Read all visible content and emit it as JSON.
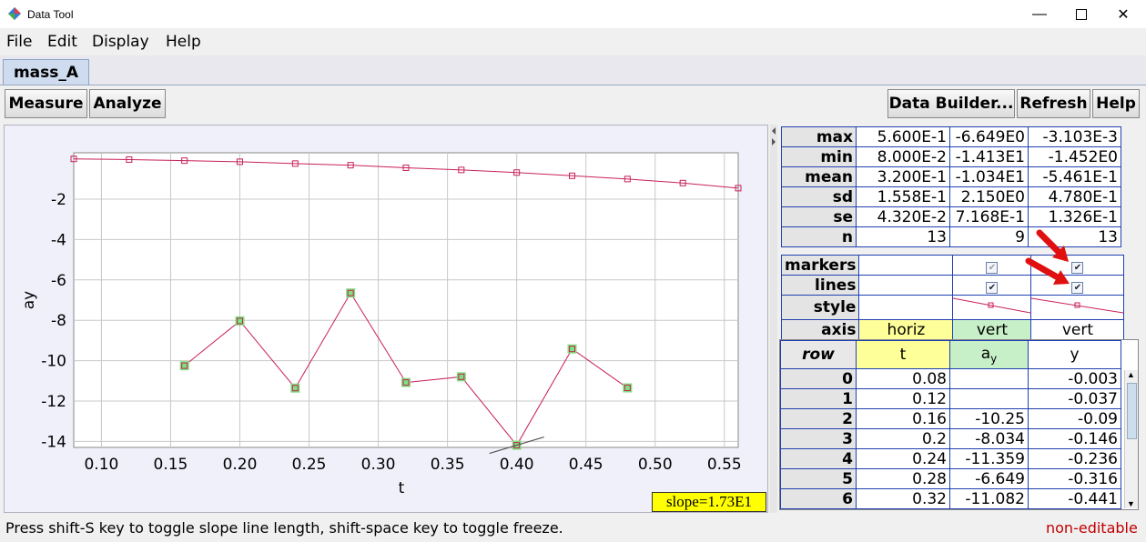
{
  "window": {
    "title": "Data Tool",
    "minimize_icon": "minimize-icon",
    "maximize_icon": "maximize-icon",
    "close_icon": "close-icon"
  },
  "menu": [
    "File",
    "Edit",
    "Display",
    "Help"
  ],
  "tab": {
    "label": "mass_A"
  },
  "toolbar": {
    "measure": "Measure",
    "analyze": "Analyze",
    "data_builder": "Data Builder...",
    "refresh": "Refresh",
    "help": "Help"
  },
  "plot": {
    "xlabel": "t",
    "ylabel": "ay",
    "slope_label": "slope=1.73E1"
  },
  "chart_data": {
    "type": "scatter",
    "xlabel": "t",
    "ylabel": "ay",
    "xlim": [
      0.08,
      0.56
    ],
    "ylim": [
      -14.3,
      0.3
    ],
    "xticks": [
      "0.10",
      "0.15",
      "0.20",
      "0.25",
      "0.30",
      "0.35",
      "0.40",
      "0.45",
      "0.50",
      "0.55"
    ],
    "yticks": [
      "-2",
      "-4",
      "-6",
      "-8",
      "-10",
      "-12",
      "-14"
    ],
    "grid": true,
    "series": [
      {
        "x": [
          0.16,
          0.2,
          0.24,
          0.28,
          0.32,
          0.36,
          0.4,
          0.44,
          0.48
        ],
        "values": [
          -10.25,
          -8.034,
          -11.359,
          -6.649,
          -11.082,
          -10.8,
          -14.19,
          -9.42,
          -11.35
        ],
        "color": "#c8205a",
        "marker_highlight": "#7fe07f"
      },
      {
        "x": [
          0.08,
          0.12,
          0.16,
          0.2,
          0.24,
          0.28,
          0.32,
          0.36,
          0.4,
          0.44,
          0.48,
          0.52,
          0.56
        ],
        "values": [
          -0.003,
          -0.037,
          -0.09,
          -0.146,
          -0.236,
          -0.316,
          -0.441,
          -0.55,
          -0.68,
          -0.84,
          -1.0,
          -1.2,
          -1.452
        ],
        "color": "#c8205a"
      }
    ]
  },
  "stats": {
    "rows": [
      {
        "label": "max",
        "t": "5.600E-1",
        "ay": "-6.649E0",
        "y": "-3.103E-3"
      },
      {
        "label": "min",
        "t": "8.000E-2",
        "ay": "-1.413E1",
        "y": "-1.452E0"
      },
      {
        "label": "mean",
        "t": "3.200E-1",
        "ay": "-1.034E1",
        "y": "-5.461E-1"
      },
      {
        "label": "sd",
        "t": "1.558E-1",
        "ay": "2.150E0",
        "y": "4.780E-1"
      },
      {
        "label": "se",
        "t": "4.320E-2",
        "ay": "7.168E-1",
        "y": "1.326E-1"
      },
      {
        "label": "n",
        "t": "13",
        "ay": "9",
        "y": "13"
      }
    ]
  },
  "props": {
    "markers": "markers",
    "lines": "lines",
    "style": "style",
    "axis": "axis",
    "axis_t": "horiz",
    "axis_ay": "vert",
    "axis_y": "vert",
    "horiz_color": "#ffff99",
    "vert_color": "#c8f0c8"
  },
  "table": {
    "headers": {
      "row": "row",
      "t": "t",
      "ay": "a",
      "ay_sub": "y",
      "y": "y"
    },
    "rows": [
      {
        "row": "0",
        "t": "0.08",
        "ay": "",
        "y": "-0.003"
      },
      {
        "row": "1",
        "t": "0.12",
        "ay": "",
        "y": "-0.037"
      },
      {
        "row": "2",
        "t": "0.16",
        "ay": "-10.25",
        "y": "-0.09"
      },
      {
        "row": "3",
        "t": "0.2",
        "ay": "-8.034",
        "y": "-0.146"
      },
      {
        "row": "4",
        "t": "0.24",
        "ay": "-11.359",
        "y": "-0.236"
      },
      {
        "row": "5",
        "t": "0.28",
        "ay": "-6.649",
        "y": "-0.316"
      },
      {
        "row": "6",
        "t": "0.32",
        "ay": "-11.082",
        "y": "-0.441"
      }
    ]
  },
  "status": {
    "message": "Press shift-S key to toggle slope line length, shift-space key to toggle freeze.",
    "editable": "non-editable"
  }
}
